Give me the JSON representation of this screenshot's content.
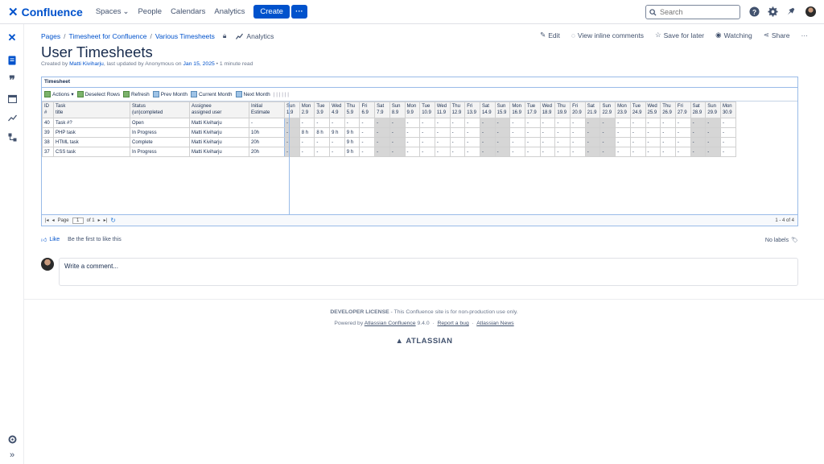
{
  "topbar": {
    "brand": "Confluence",
    "nav": [
      "Spaces",
      "People",
      "Calendars",
      "Analytics"
    ],
    "create_label": "Create",
    "more_label": "···",
    "search_placeholder": "Search"
  },
  "breadcrumb": [
    "Pages",
    "Timesheet for Confluence",
    "Various Timesheets"
  ],
  "analytics_label": "Analytics",
  "page_actions": {
    "edit": "Edit",
    "inline_comments": "View inline comments",
    "save_later": "Save for later",
    "watching": "Watching",
    "share": "Share",
    "more": "···"
  },
  "page": {
    "title": "User Timesheets",
    "byline_prefix": "Created by",
    "author": "Matti Kiviharju",
    "byline_mid": ", last updated by Anonymous on",
    "updated": "Jan 15, 2025",
    "byline_suffix": "• 1 minute read"
  },
  "timesheet": {
    "panel_title": "Timesheet",
    "toolbar": [
      "Actions",
      "Deselect Rows",
      "Refresh",
      "Prev Month",
      "Current Month",
      "Next Month"
    ],
    "columns": [
      {
        "l1": "ID",
        "l2": "#"
      },
      {
        "l1": "Task",
        "l2": "title"
      },
      {
        "l1": "Status",
        "l2": "(un)completed"
      },
      {
        "l1": "Assignee",
        "l2": "assigned user"
      },
      {
        "l1": "Initial",
        "l2": "Estimate"
      }
    ],
    "days": [
      {
        "d": "Sun",
        "n": "1.9",
        "w": true
      },
      {
        "d": "Mon",
        "n": "2.9",
        "w": false
      },
      {
        "d": "Tue",
        "n": "3.9",
        "w": false
      },
      {
        "d": "Wed",
        "n": "4.9",
        "w": false
      },
      {
        "d": "Thu",
        "n": "5.9",
        "w": false
      },
      {
        "d": "Fri",
        "n": "6.9",
        "w": false
      },
      {
        "d": "Sat",
        "n": "7.9",
        "w": true
      },
      {
        "d": "Sun",
        "n": "8.9",
        "w": true
      },
      {
        "d": "Mon",
        "n": "9.9",
        "w": false
      },
      {
        "d": "Tue",
        "n": "10.9",
        "w": false
      },
      {
        "d": "Wed",
        "n": "11.9",
        "w": false
      },
      {
        "d": "Thu",
        "n": "12.9",
        "w": false
      },
      {
        "d": "Fri",
        "n": "13.9",
        "w": false
      },
      {
        "d": "Sat",
        "n": "14.9",
        "w": true
      },
      {
        "d": "Sun",
        "n": "15.9",
        "w": true
      },
      {
        "d": "Mon",
        "n": "16.9",
        "w": false
      },
      {
        "d": "Tue",
        "n": "17.9",
        "w": false
      },
      {
        "d": "Wed",
        "n": "18.9",
        "w": false
      },
      {
        "d": "Thu",
        "n": "19.9",
        "w": false
      },
      {
        "d": "Fri",
        "n": "20.9",
        "w": false
      },
      {
        "d": "Sat",
        "n": "21.9",
        "w": true
      },
      {
        "d": "Sun",
        "n": "22.9",
        "w": true
      },
      {
        "d": "Mon",
        "n": "23.9",
        "w": false
      },
      {
        "d": "Tue",
        "n": "24.9",
        "w": false
      },
      {
        "d": "Wed",
        "n": "25.9",
        "w": false
      },
      {
        "d": "Thu",
        "n": "26.9",
        "w": false
      },
      {
        "d": "Fri",
        "n": "27.9",
        "w": false
      },
      {
        "d": "Sat",
        "n": "28.9",
        "w": true
      },
      {
        "d": "Sun",
        "n": "29.9",
        "w": true
      },
      {
        "d": "Mon",
        "n": "30.9",
        "w": false
      }
    ],
    "rows": [
      {
        "id": "40",
        "task": "Task #?",
        "status": "Open",
        "assignee": "Matti Kiviharju",
        "estimate": "-",
        "hours": {}
      },
      {
        "id": "39",
        "task": "PHP task",
        "status": "In Progress",
        "assignee": "Matti Kiviharju",
        "estimate": "10h",
        "hours": {
          "1": "8 h",
          "2": "8 h",
          "3": "9 h",
          "4": "9 h"
        }
      },
      {
        "id": "38",
        "task": "HTML task",
        "status": "Complete",
        "assignee": "Matti Kiviharju",
        "estimate": "20h",
        "hours": {
          "4": "9 h"
        }
      },
      {
        "id": "37",
        "task": "CSS task",
        "status": "In Progress",
        "assignee": "Matti Kiviharju",
        "estimate": "20h",
        "hours": {
          "4": "9 h"
        }
      }
    ],
    "pager": {
      "page_label": "Page",
      "page_value": "1",
      "of_label": "of 1",
      "count": "1 - 4 of 4"
    }
  },
  "like": {
    "label": "Like",
    "first": "Be the first to like this"
  },
  "labels": {
    "text": "No labels"
  },
  "comment": {
    "placeholder": "Write a comment..."
  },
  "footer": {
    "license_bold": "DEVELOPER LICENSE",
    "license_rest": " - This Confluence site is for non-production use only.",
    "powered_prefix": "Powered by ",
    "powered_link": "Atlassian Confluence",
    "version": " 9.4.0",
    "report": "Report a bug",
    "news": "Atlassian News",
    "brand": "ATLASSIAN"
  },
  "colors": {
    "brand": "#0052cc",
    "weekend": "#d6d6d6",
    "grid_border": "#99bbe8"
  }
}
